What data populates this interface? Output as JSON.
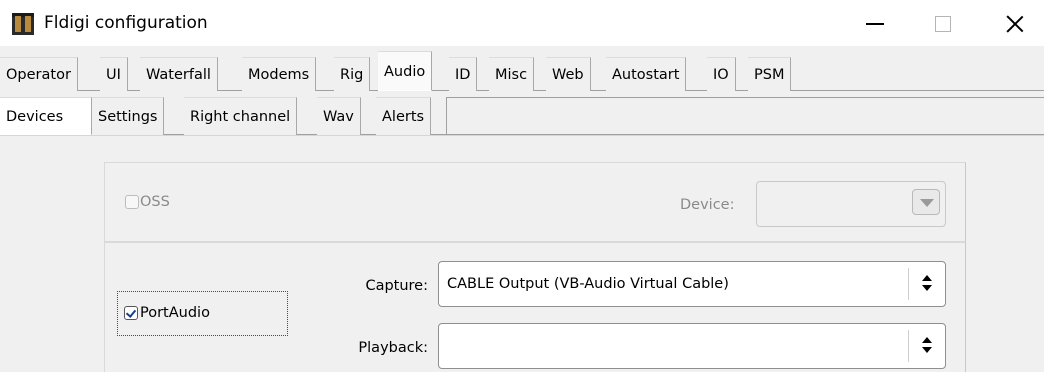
{
  "window": {
    "title": "Fldigi configuration",
    "icon": "fldigi-app-icon",
    "minimize_icon": "minimize-icon",
    "maximize_icon": "maximize-icon",
    "close_icon": "close-icon"
  },
  "tabs": {
    "main": [
      "Operator",
      "UI",
      "Waterfall",
      "Modems",
      "Rig",
      "Audio",
      "ID",
      "Misc",
      "Web",
      "Autostart",
      "IO",
      "PSM"
    ],
    "main_active": "Audio",
    "sub": [
      "Devices",
      "Settings",
      "Right channel",
      "Wav",
      "Alerts"
    ],
    "sub_active": "Devices"
  },
  "devices": {
    "oss": {
      "label": "OSS",
      "checked": false,
      "enabled": false,
      "device_label": "Device:",
      "device_value": ""
    },
    "portaudio": {
      "label": "PortAudio",
      "checked": true,
      "capture_label": "Capture:",
      "capture_value": "CABLE Output (VB-Audio Virtual Cable)",
      "playback_label": "Playback:",
      "playback_value": ""
    }
  },
  "colors": {
    "window_bg": "#f0f0f0",
    "titlebar_bg": "#ffffff",
    "checkmark": "#1a3c8f",
    "disabled_text": "#8a8a8a"
  }
}
